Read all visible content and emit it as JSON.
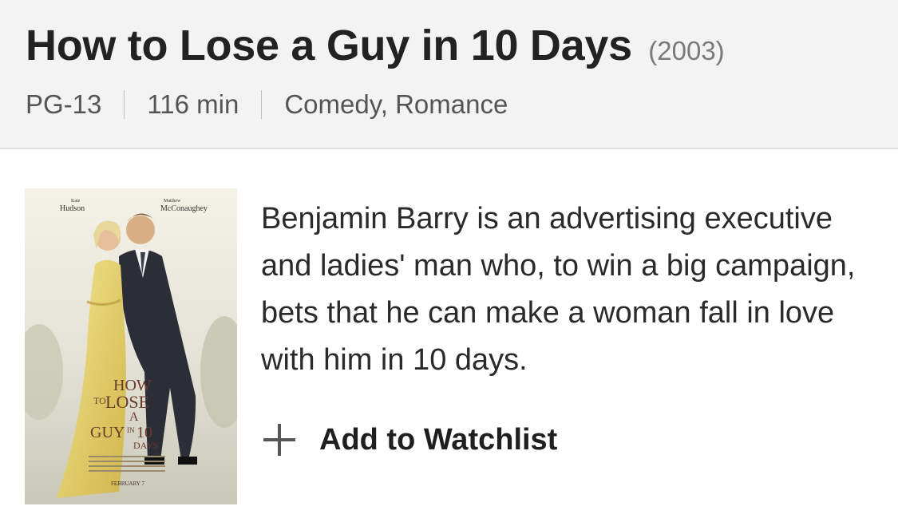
{
  "movie": {
    "title": "How to Lose a Guy in 10 Days",
    "year": "(2003)",
    "rating": "PG-13",
    "runtime": "116 min",
    "genres": "Comedy, Romance",
    "description": "Benjamin Barry is an advertising executive and ladies' man who, to win a big campaign, bets that he can make a woman fall in love with him in 10 days."
  },
  "poster": {
    "actor_left_first": "Kate",
    "actor_left_last": "Hudson",
    "actor_right_first": "Matthew",
    "actor_right_last": "McConaughey",
    "logo_how": "HOW",
    "logo_to": "TO",
    "logo_lose": "LOSE",
    "logo_a": "A",
    "logo_guy": "GUY",
    "logo_in": "IN",
    "logo_10": "10",
    "logo_days": "DAYS",
    "release": "FEBRUARY 7"
  },
  "actions": {
    "watchlist_label": "Add to Watchlist",
    "watchlist_icon": "plus-icon"
  },
  "colors": {
    "header_bg": "#f3f3f3",
    "dress": "#e8d67a",
    "suit": "#2b2e36"
  }
}
